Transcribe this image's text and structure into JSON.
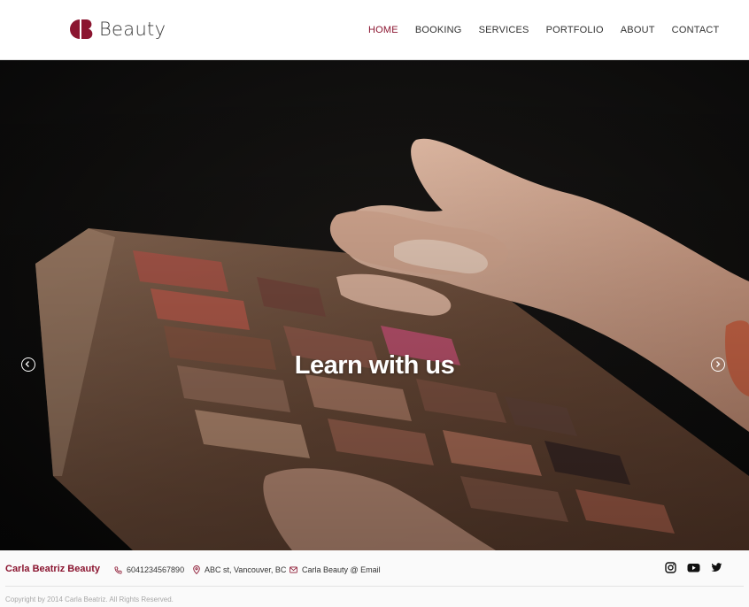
{
  "header": {
    "logo_text": "Beauty",
    "nav": [
      {
        "label": "HOME",
        "active": true
      },
      {
        "label": "BOOKING",
        "active": false
      },
      {
        "label": "SERVICES",
        "active": false
      },
      {
        "label": "PORTFOLIO",
        "active": false
      },
      {
        "label": "ABOUT",
        "active": false
      },
      {
        "label": "CONTACT",
        "active": false
      }
    ]
  },
  "hero": {
    "title": "Learn with us",
    "slide_count": 5,
    "active_slide": 4,
    "prev_icon": "chevron-left-circle-icon",
    "next_icon": "chevron-right-circle-icon"
  },
  "footer": {
    "brand": "Carla Beatriz Beauty",
    "phone": "6041234567890",
    "address": "ABC st, Vancouver, BC",
    "email": "Carla Beauty @ Email",
    "social": [
      "instagram-icon",
      "youtube-icon",
      "twitter-icon"
    ],
    "copyright": "Copyright by 2014 Carla Beatriz. All Rights Reserved."
  },
  "colors": {
    "accent": "#8b1530",
    "text": "#333333",
    "muted": "#a8a8a8"
  }
}
